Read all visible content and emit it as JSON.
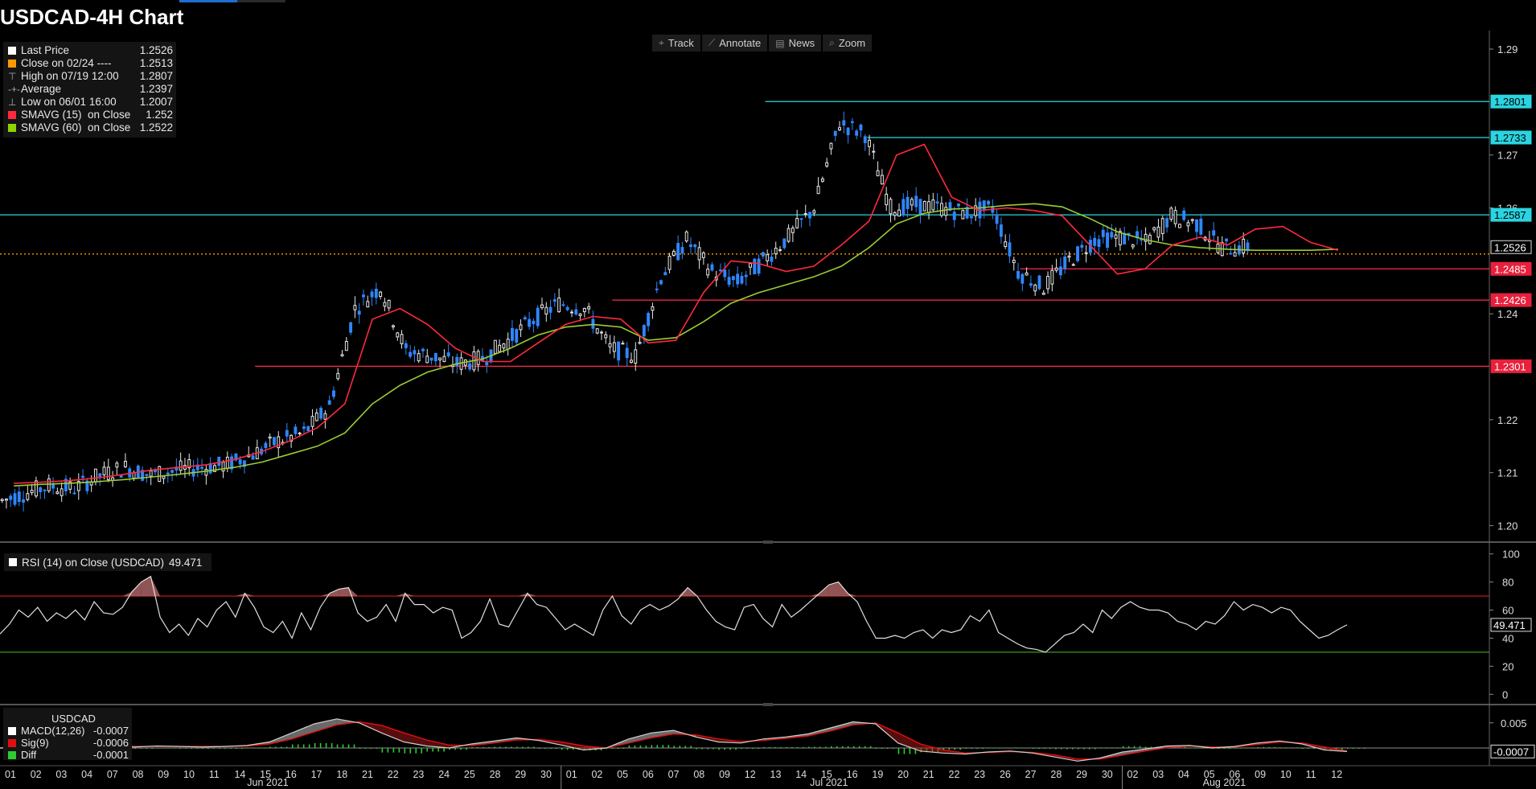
{
  "title": "USDCAD-4H Chart",
  "toolbar": [
    {
      "label": "Track",
      "icon": "crosshair-icon",
      "glyph": "⌖"
    },
    {
      "label": "Annotate",
      "icon": "pencil-icon",
      "glyph": "⟋"
    },
    {
      "label": "News",
      "icon": "news-icon",
      "glyph": "▤"
    },
    {
      "label": "Zoom",
      "icon": "zoom-icon",
      "glyph": "⌕"
    }
  ],
  "legend": [
    {
      "label": "Last Price",
      "value": "1.2526",
      "marker": "square",
      "color": "#ffffff"
    },
    {
      "label": "Close on 02/24 ----",
      "value": "1.2513",
      "marker": "square",
      "color": "#ff9900"
    },
    {
      "label": "High on 07/19 12:00",
      "value": "1.2807",
      "marker": "glyph",
      "glyph": "⊤"
    },
    {
      "label": "Average",
      "value": "1.2397",
      "marker": "glyph",
      "glyph": "-+-"
    },
    {
      "label": "Low on 06/01 16:00",
      "value": "1.2007",
      "marker": "glyph",
      "glyph": "⊥"
    },
    {
      "label": "SMAVG (15)  on Close",
      "value": "1.252",
      "marker": "square",
      "color": "#ff2a3c"
    },
    {
      "label": "SMAVG (60)  on Close",
      "value": "1.2522",
      "marker": "square",
      "color": "#8fd400"
    }
  ],
  "colors": {
    "up_candle": "#e8e8e8",
    "down_candle": "#2f86ff",
    "sma15": "#ff2a3c",
    "sma60": "#9acd32",
    "resistance": "#2ad4e0",
    "support": "#ff2a4a",
    "close_ref": "#ff9900",
    "rsi_line": "#e0e0e0",
    "rsi_upper": "#c01818",
    "rsi_lower": "#3a9a20",
    "macd_line": "#d0d0d0",
    "signal_line": "#e01010",
    "diff_bar": "#2ecc2e"
  },
  "chart_data": [
    {
      "type": "candlestick",
      "name": "USDCAD-4H",
      "y_axis": {
        "ticks": [
          "1.29",
          "1.27",
          "1.26",
          "1.24",
          "1.22",
          "1.21",
          "1.20"
        ],
        "ylim": [
          1.1975,
          1.2935
        ]
      },
      "price_labels": [
        {
          "value": "1.2801",
          "kind": "resistance"
        },
        {
          "value": "1.2733",
          "kind": "resistance"
        },
        {
          "value": "1.2587",
          "kind": "resistance"
        },
        {
          "value": "1.2526",
          "kind": "last"
        },
        {
          "value": "1.2485",
          "kind": "support"
        },
        {
          "value": "1.2426",
          "kind": "support"
        },
        {
          "value": "1.2301",
          "kind": "support"
        }
      ],
      "horizontal_levels": [
        {
          "value": 1.2801,
          "from_day": 30,
          "kind": "resistance"
        },
        {
          "value": 1.2733,
          "from_day": 34,
          "kind": "resistance"
        },
        {
          "value": 1.2587,
          "from_day": 0,
          "kind": "resistance"
        },
        {
          "value": 1.2513,
          "from_day": 0,
          "kind": "close_ref"
        },
        {
          "value": 1.2485,
          "from_day": 40,
          "kind": "support"
        },
        {
          "value": 1.2426,
          "from_day": 24,
          "kind": "support"
        },
        {
          "value": 1.2301,
          "from_day": 10,
          "kind": "support"
        }
      ],
      "daily_closes": [
        1.206,
        1.2075,
        1.207,
        1.2095,
        1.211,
        1.2095,
        1.2105,
        1.211,
        1.2115,
        1.2135,
        1.216,
        1.2175,
        1.2225,
        1.241,
        1.245,
        1.233,
        1.232,
        1.2305,
        1.2315,
        1.235,
        1.239,
        1.242,
        1.241,
        1.2335,
        1.232,
        1.247,
        1.254,
        1.248,
        1.246,
        1.25,
        1.2545,
        1.26,
        1.276,
        1.274,
        1.26,
        1.2605,
        1.26,
        1.259,
        1.26,
        1.248,
        1.245,
        1.25,
        1.254,
        1.2545,
        1.2535,
        1.2585,
        1.257,
        1.2525,
        1.2526
      ],
      "sma15": [
        1.208,
        1.2082,
        1.2085,
        1.209,
        1.2097,
        1.2105,
        1.211,
        1.2115,
        1.2125,
        1.214,
        1.216,
        1.2185,
        1.223,
        1.239,
        1.241,
        1.238,
        1.2335,
        1.231,
        1.231,
        1.2345,
        1.238,
        1.2395,
        1.239,
        1.2345,
        1.235,
        1.244,
        1.25,
        1.2495,
        1.248,
        1.249,
        1.253,
        1.2575,
        1.27,
        1.272,
        1.262,
        1.2595,
        1.26,
        1.2595,
        1.2585,
        1.253,
        1.2475,
        1.2485,
        1.253,
        1.2545,
        1.253,
        1.256,
        1.2565,
        1.2535,
        1.252
      ],
      "sma60": [
        1.2075,
        1.2078,
        1.208,
        1.2083,
        1.2087,
        1.2092,
        1.2097,
        1.2103,
        1.211,
        1.212,
        1.2135,
        1.215,
        1.2175,
        1.223,
        1.2265,
        1.229,
        1.2305,
        1.2315,
        1.2335,
        1.236,
        1.2375,
        1.238,
        1.2375,
        1.235,
        1.2355,
        1.2385,
        1.242,
        1.244,
        1.2455,
        1.247,
        1.249,
        1.2525,
        1.257,
        1.259,
        1.2598,
        1.26,
        1.2605,
        1.2608,
        1.2602,
        1.258,
        1.2555,
        1.254,
        1.253,
        1.2525,
        1.2522,
        1.252,
        1.252,
        1.252,
        1.2522
      ],
      "x_axis": {
        "days": [
          "01",
          "02",
          "03",
          "04",
          "07",
          "08",
          "09",
          "10",
          "11",
          "14",
          "15",
          "16",
          "17",
          "18",
          "21",
          "22",
          "23",
          "24",
          "25",
          "28",
          "29",
          "30",
          "01",
          "02",
          "05",
          "06",
          "07",
          "08",
          "09",
          "12",
          "13",
          "14",
          "15",
          "16",
          "19",
          "20",
          "21",
          "22",
          "23",
          "26",
          "27",
          "28",
          "29",
          "30",
          "02",
          "03",
          "04",
          "05",
          "06",
          "09",
          "10",
          "11",
          "12"
        ],
        "months": [
          {
            "label": "Jun 2021",
            "day_index": 10.5
          },
          {
            "label": "Jul 2021",
            "day_index": 32.5
          },
          {
            "label": "Aug 2021",
            "day_index": 48
          }
        ],
        "separators": [
          22,
          44
        ]
      }
    },
    {
      "type": "line",
      "name": "RSI",
      "legend": {
        "label": "RSI (14)  on Close (USDCAD)",
        "value": "49.471"
      },
      "ylim": [
        -5,
        105
      ],
      "ticks": [
        "100",
        "80",
        "60",
        "40",
        "20",
        "0"
      ],
      "levels": [
        70,
        30
      ],
      "last_label": "49.471",
      "values": [
        43,
        50,
        60,
        55,
        62,
        52,
        58,
        54,
        60,
        53,
        66,
        58,
        57,
        62,
        73,
        80,
        84,
        55,
        44,
        50,
        42,
        54,
        48,
        60,
        66,
        55,
        72,
        62,
        48,
        44,
        52,
        40,
        58,
        46,
        62,
        72,
        75,
        76,
        58,
        52,
        55,
        64,
        52,
        72,
        64,
        64,
        58,
        62,
        60,
        40,
        44,
        52,
        68,
        50,
        48,
        60,
        72,
        64,
        62,
        54,
        46,
        50,
        46,
        42,
        60,
        70,
        56,
        50,
        60,
        64,
        60,
        63,
        68,
        76,
        70,
        60,
        52,
        48,
        46,
        62,
        64,
        54,
        48,
        64,
        55,
        60,
        66,
        72,
        78,
        80,
        72,
        66,
        52,
        40,
        40,
        42,
        40,
        44,
        46,
        40,
        46,
        44,
        46,
        56,
        52,
        60,
        44,
        40,
        36,
        33,
        32,
        30,
        36,
        42,
        44,
        50,
        44,
        60,
        54,
        62,
        66,
        62,
        60,
        60,
        58,
        52,
        50,
        46,
        52,
        50,
        56,
        66,
        60,
        64,
        62,
        58,
        62,
        60,
        52,
        46,
        40,
        42,
        46,
        49.471
      ]
    },
    {
      "type": "line",
      "name": "MACD",
      "legend_title": "USDCAD",
      "legend": [
        {
          "label": "MACD(12,26)",
          "value": "-0.0007",
          "color": "#ffffff"
        },
        {
          "label": "Sig(9)",
          "value": "-0.0006",
          "color": "#e01010"
        },
        {
          "label": "Diff",
          "value": "-0.0001",
          "color": "#2ecc2e"
        }
      ],
      "ticks": [
        "0.005"
      ],
      "ylim": [
        -0.0032,
        0.008
      ],
      "last_label": "-0.0007",
      "macd": [
        0.0,
        0.0002,
        0.0003,
        0.0001,
        0.0004,
        0.0003,
        0.0002,
        0.0004,
        0.0003,
        0.0002,
        0.0003,
        0.0005,
        0.0012,
        0.003,
        0.0048,
        0.0058,
        0.005,
        0.003,
        0.0012,
        0.0004,
        0.0,
        0.0008,
        0.0014,
        0.002,
        0.0015,
        0.0006,
        -0.0004,
        0.0,
        0.0018,
        0.003,
        0.0035,
        0.0022,
        0.0012,
        0.001,
        0.0018,
        0.0022,
        0.0028,
        0.004,
        0.0052,
        0.0048,
        0.001,
        -0.0006,
        -0.001,
        -0.0012,
        -0.0008,
        -0.0006,
        -0.001,
        -0.0018,
        -0.0026,
        -0.002,
        -0.0008,
        -0.0002,
        0.0004,
        0.0005,
        0.0,
        0.0003,
        0.001,
        0.0014,
        0.0008,
        -0.0004,
        -0.0007
      ],
      "signal": [
        0.0,
        0.0001,
        0.0002,
        0.0002,
        0.0002,
        0.0003,
        0.0003,
        0.0003,
        0.0003,
        0.0003,
        0.0003,
        0.0004,
        0.0008,
        0.0018,
        0.0032,
        0.0046,
        0.0052,
        0.0045,
        0.003,
        0.0016,
        0.0006,
        0.0005,
        0.001,
        0.0016,
        0.0017,
        0.0012,
        0.0004,
        0.0,
        0.001,
        0.002,
        0.0028,
        0.0026,
        0.0018,
        0.0013,
        0.0015,
        0.0019,
        0.0024,
        0.0034,
        0.0046,
        0.005,
        0.003,
        0.0008,
        -0.0004,
        -0.001,
        -0.0009,
        -0.0007,
        -0.0009,
        -0.0014,
        -0.0022,
        -0.0022,
        -0.0014,
        -0.0006,
        0.0001,
        0.0004,
        0.0002,
        0.0002,
        0.0007,
        0.0012,
        0.001,
        0.0002,
        -0.0006
      ]
    }
  ]
}
